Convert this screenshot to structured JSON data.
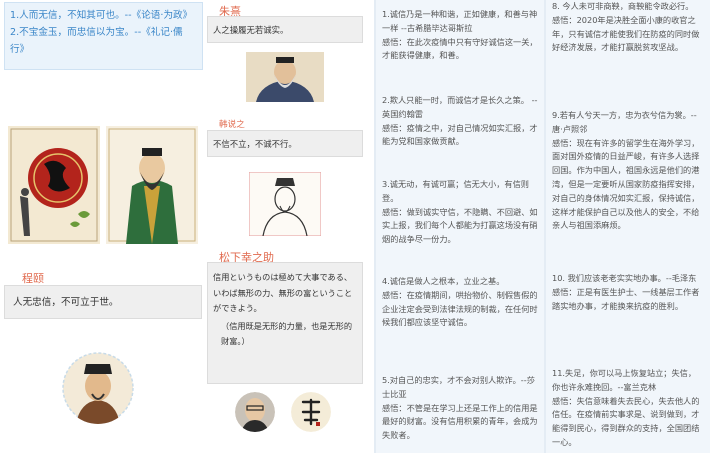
{
  "col1": {
    "quotes": [
      "1.人而无信，不知其可也。--《论语·为政》",
      "2.不宝金玉，而忠信以为宝。--《礼记·儒行》"
    ],
    "heading": "程颐",
    "saying": "人无忠信，不可立于世。"
  },
  "col2": {
    "h1": "朱熹",
    "t1": "人之操履无若诚实。",
    "h2": "韩说之",
    "t2": "不信不立，不诚不行。",
    "h3": "松下幸之助",
    "t3_jp": "信用というものは極めて大事である、いわば無形の力、無形の富ということができよう。",
    "t3_cn": "（信用既是无形的力量，也是无形的财富。）"
  },
  "col3": {
    "paras": [
      [
        "1.诚信乃是一种和谐，正如健康，和善与神一样  --古希腊毕达哥斯拉",
        "感悟：在此次疫情中只有守好诚信这一关，才能获得健康，和善。"
      ],
      [
        "2.欺人只能一时，而诚信才是长久之策。  --英国约翰雷",
        "感悟：疫情之中，对自己情况如实汇报，才能为党和国家做贡献。"
      ],
      [
        "3.诚无动，有诚可赢；信无大小，有信则登。",
        "感悟：做到诚实守信，不隐瞒、不回避、如实上报，我们每个人都能为打赢这场没有硝烟的战争尽一份力。"
      ],
      [
        "4.诚信是做人之根本，立业之基。",
        "感悟：在疫情期间，哄抬物价、制假售假的企业注定会受到法律法规的制裁，在任何时候我们都应该坚守诚信。"
      ],
      [
        "5.对自己的忠实，才不会对别人欺诈。--莎士比亚",
        "感悟：不管是在学习上还是工作上的信用是最好的财富。没有信用积累的青年，会成为失败者。"
      ]
    ]
  },
  "col4": {
    "paras": [
      [
        "8. 今人未可非商鞅，商鞅能令政必行。",
        "感悟：2020年是决胜全面小康的收官之年，只有诚信才能使我们在防疫的同时做好经济发展，才能打赢脱贫攻坚战。"
      ],
      [
        "9.若有人兮天一方，忠为衣兮信为裳。--唐·卢照邻",
        "感悟：现在有许多的留学生在海外学习，面对国外疫情的日益严峻，有许多人选择回国。作为中国人，祖国永远是他们的港湾，但是一定要听从国家防疫指挥安排，对自己的身体情况如实汇报，保持诚信，这样才能保护自己以及他人的安全，不给亲人与祖国添麻烦。"
      ],
      [
        "10. 我们应该老老实实地办事。--毛泽东",
        "感悟：正是有医生护士、一线基层工作者踏实地办事，才能换来抗疫的胜利。"
      ],
      [
        "11.失足，你可以马上恢复站立；失信，你也许永难挽回。--富兰克林",
        "感悟：失信意味着失去民心，失去他人的信任。在疫情前实事求是、说到做到，才能得到民心，得到群众的支持，全国团结一心。"
      ]
    ]
  },
  "colors": {
    "accent_blue": "#3a86c8",
    "accent_red": "#e06a4e",
    "panel": "#f1f6fb"
  }
}
